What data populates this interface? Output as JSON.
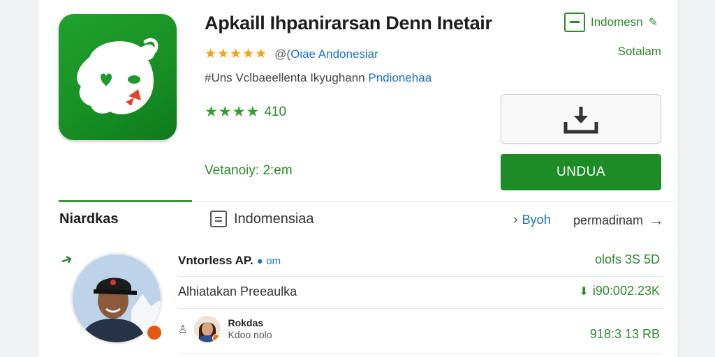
{
  "app": {
    "title": "Apkaill Ihpanirarsan Denn Inetair",
    "stars_top": "★★★★★",
    "developer_prefix": "@(",
    "developer_link": "Oiae Andonesiar",
    "description_prefix": "#Uns Vclbaeellenta Ikyughann ",
    "description_highlight": "Pndionehaa",
    "stars_green": "★★★★",
    "score": "410",
    "version": "Vetanoiy: 2:em"
  },
  "top_right": {
    "language": "Indomesn",
    "sub": "Sotalam"
  },
  "actions": {
    "install_label": "UNDUA"
  },
  "tabs": {
    "main": "Niardkas",
    "language": "Indomensiaa",
    "link_byoh": "Byoh",
    "link_more": "permadinam"
  },
  "listing": {
    "row1_title": "Vntorless AP.",
    "row1_title_suffix": "om",
    "row1_value": "olofs 3S 5D",
    "row2_text": "Alhiatakan Preeaulka",
    "row2_value": "i90:002.23K",
    "mini_name": "Rokdas",
    "mini_sub": "Kdoo nolo",
    "row3_value": "918:3 13 RB"
  },
  "colors": {
    "brand_green": "#1d8c26",
    "text_green": "#2c8a2c",
    "link_blue": "#1a73c9",
    "star_orange": "#f3a11a"
  },
  "icons": {
    "app": "ghost-mascot-icon",
    "download": "download-icon",
    "language": "language-box-icon",
    "doc": "document-icon",
    "pin": "map-pin-icon",
    "person": "person-icon",
    "chevron": "chevron-right-icon",
    "arrow": "arrow-right-icon"
  }
}
